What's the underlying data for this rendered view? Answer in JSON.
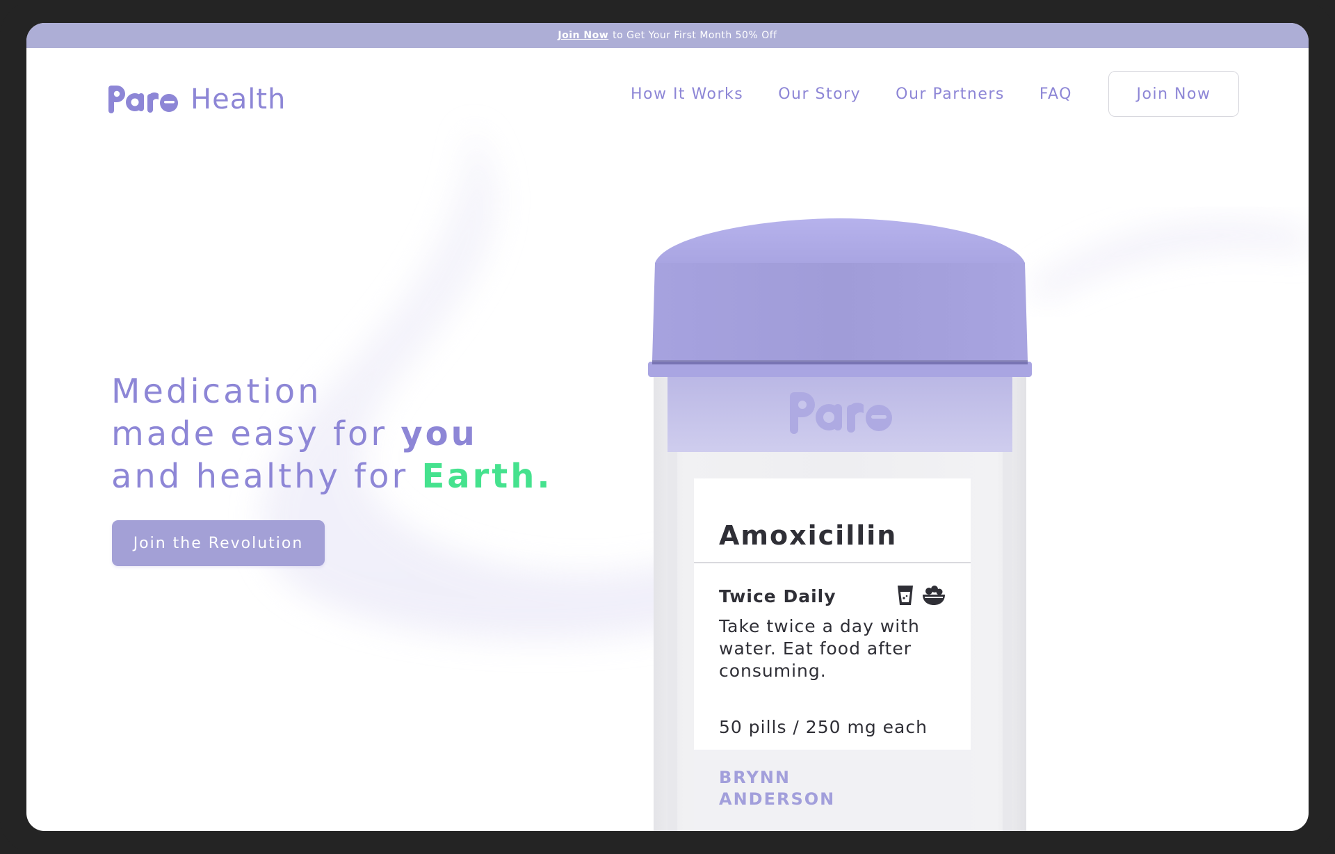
{
  "promo": {
    "link_label": "Join Now",
    "text": "to Get Your First Month 50% Off"
  },
  "header": {
    "logo_mark": "Pare",
    "logo_text": "Health",
    "nav": [
      "How It Works",
      "Our Story",
      "Our Partners",
      "FAQ"
    ],
    "cta_label": "Join Now"
  },
  "hero": {
    "line1": "Medication",
    "line2_prefix": "made easy for ",
    "line2_emph": "you",
    "line3_prefix": "and healthy for ",
    "line3_emph": "Earth.",
    "cta_label": "Join the Revolution"
  },
  "bottle": {
    "brand": "Pare",
    "label": {
      "drug_name": "Amoxicillin",
      "frequency": "Twice Daily",
      "instructions": "Take twice a day with water. Eat food after consuming.",
      "quantity": "50 pills / 250 mg each",
      "patient_first": "BRYNN",
      "patient_last": "ANDERSON",
      "icons": [
        "water-glass-icon",
        "food-bowl-icon"
      ]
    }
  },
  "colors": {
    "brand_purple": "#8d86d6",
    "promo_bar": "#adaed6",
    "accent_green": "#45e28e",
    "cap_purple": "#a5a0dc",
    "cta_fill": "#a3a0d6"
  }
}
